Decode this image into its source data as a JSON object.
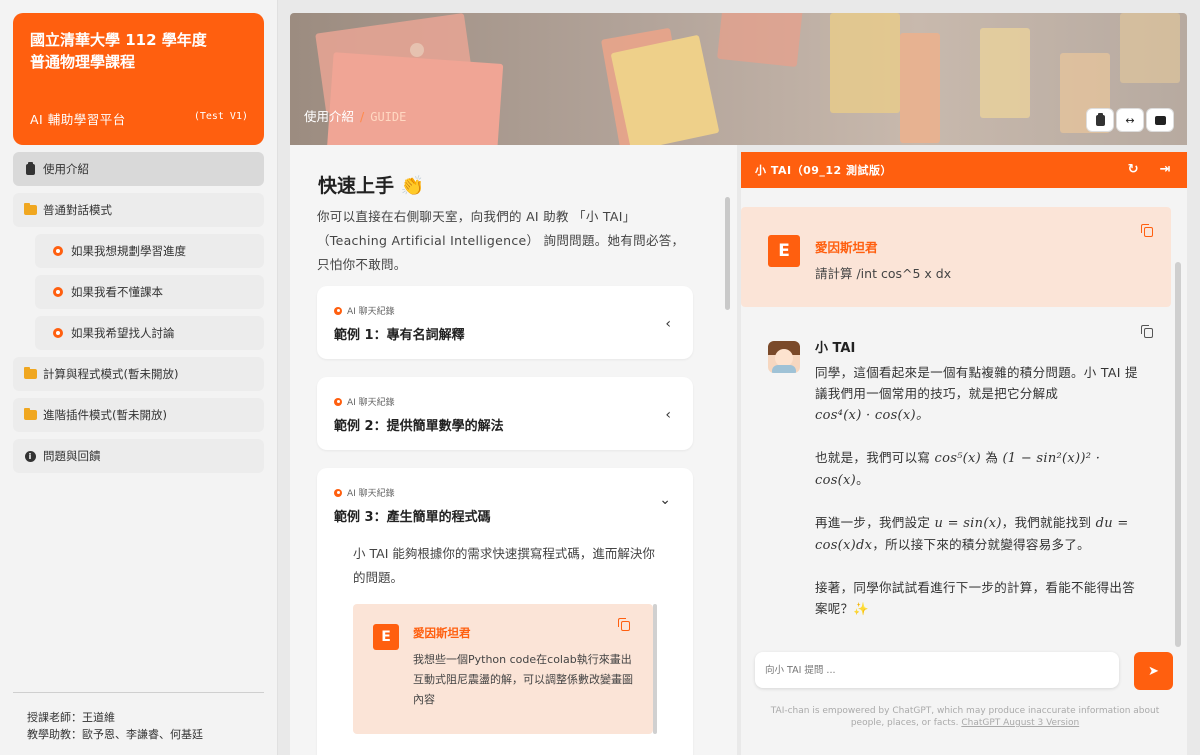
{
  "brand": {
    "title_line1": "國立清華大學 112 學年度",
    "title_line2": "普通物理學課程",
    "subtitle": "AI 輔助學習平台",
    "version": "(Test V1)"
  },
  "sidebar": {
    "items": [
      {
        "label": "使用介紹",
        "icon": "clipboard-icon"
      },
      {
        "label": "普通對話模式",
        "icon": "folder-icon"
      },
      {
        "label": "如果我想規劃學習進度",
        "icon": "chat-icon"
      },
      {
        "label": "如果我看不懂課本",
        "icon": "chat-icon"
      },
      {
        "label": "如果我希望找人討論",
        "icon": "chat-icon"
      },
      {
        "label": "計算與程式模式(暫未開放)",
        "icon": "folder-icon"
      },
      {
        "label": "進階插件模式(暫未開放)",
        "icon": "folder-icon"
      },
      {
        "label": "問題與回饋",
        "icon": "info-icon"
      }
    ],
    "footer": {
      "teacher": "授課老師：王道維",
      "assistants": "教學助教：歐予恩、李謙睿、何基廷"
    }
  },
  "hero": {
    "crumb_main": "使用介紹",
    "crumb_sep": "/",
    "crumb_sub": "GUIDE"
  },
  "main": {
    "heading": "快速上手",
    "heading_emoji": "👏",
    "intro": "你可以直接在右側聊天室，向我們的 AI 助教 「小 TAI」（Teaching Artificial Intelligence） 詢問問題。她有問必答，只怕你不敢問。",
    "cards": [
      {
        "tag": "AI 聊天紀錄",
        "title": "範例 1：專有名詞解釋",
        "chevron": "‹"
      },
      {
        "tag": "AI 聊天紀錄",
        "title": "範例 2：提供簡單數學的解法",
        "chevron": "‹"
      },
      {
        "tag": "AI 聊天紀錄",
        "title": "範例 3：產生簡單的程式碼",
        "chevron": "⌄",
        "body": "小 TAI 能夠根據你的需求快速撰寫程式碼，進而解決你的問題。",
        "example_msg": {
          "avatar": "E",
          "name": "愛因斯坦君",
          "text": "我想些一個Python code在colab執行來畫出互動式阻尼震盪的解，可以調整係數改變畫圖內容"
        }
      }
    ]
  },
  "chat": {
    "header": "小 TAI（09_12 測試版）",
    "user_msg": {
      "avatar": "E",
      "name": "愛因斯坦君",
      "text": "請計算 /int cos^5 x dx"
    },
    "bot_msg": {
      "name": "小 TAI",
      "p1": "同學，這個看起來是一個有點複雜的積分問題。小 TAI 提議我們用一個常用的技巧，就是把它分解成",
      "p1_math": "cos⁴(x) · cos(x)。",
      "p2": "也就是，我們可以寫",
      "p2_math_a": "cos⁵(x)",
      "p2_mid": "為",
      "p2_math_b": "(1 − sin²(x))² · cos(x)",
      "p2_end": "。",
      "p3": "再進一步，我們設定",
      "p3_math_a": "u = sin(x)",
      "p3_mid": "，我們就能找到",
      "p3_math_b": "du = cos(x)dx",
      "p3_end": "，所以接下來的積分就變得容易多了。",
      "p4": "接著，同學你試試看進行下一步的計算，看能不能得出答案呢？✨"
    },
    "input_placeholder": "向小 TAI 提問 ...",
    "disclaimer": "TAI-chan is empowered by ChatGPT, which may produce inaccurate information about people, places, or facts.",
    "disclaimer_link": "ChatGPT August 3 Version"
  },
  "colors": {
    "accent": "#ff5f0f",
    "user_bubble": "#fbe4d7"
  }
}
